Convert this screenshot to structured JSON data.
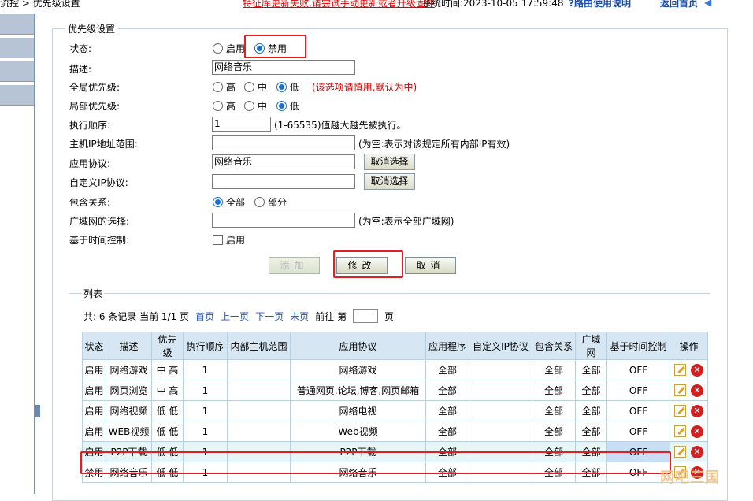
{
  "topbar": {
    "breadcrumb": "流控 > 优先级设置",
    "warning": "特征库更新失败,请尝试手动更新或者升级固件",
    "system_time": "系统时间:2023-10-05 17:59:48",
    "help": "路由使用说明",
    "back": "返回首页"
  },
  "form": {
    "legend": "优先级设置",
    "status_label": "状态:",
    "status_enable": "启用",
    "status_disable": "禁用",
    "status_value": "禁用",
    "desc_label": "描述:",
    "desc_value": "网络音乐",
    "global_label": "全局优先级:",
    "global_opts": [
      "高",
      "中",
      "低"
    ],
    "global_selected": "低",
    "global_hint": "(该选项请慎用,默认为中)",
    "local_label": "局部优先级:",
    "local_opts": [
      "高",
      "中",
      "低"
    ],
    "local_selected": "低",
    "order_label": "执行顺序:",
    "order_value": "1",
    "order_hint": "(1-65535)值越大越先被执行。",
    "ip_label": "主机IP地址范围:",
    "ip_value": "",
    "ip_hint": "(为空:表示对该规定所有内部IP有效)",
    "proto_label": "应用协议:",
    "proto_value": "网络音乐",
    "cancel_select": "取消选择",
    "custom_label": "自定义IP协议:",
    "custom_value": "",
    "include_label": "包含关系:",
    "include_all": "全部",
    "include_part": "部分",
    "include_selected": "全部",
    "wan_label": "广域网的选择:",
    "wan_value": "",
    "wan_hint": "(为空:表示全部广域网)",
    "time_label": "基于时间控制:",
    "time_enable": "启用",
    "btn_add": "添加",
    "btn_modify": "修改",
    "btn_cancel": "取消"
  },
  "list": {
    "legend": "列表",
    "summary": "共: 6 条记录 当前 1/1 页",
    "first": "首页",
    "prev": "上一页",
    "next": "下一页",
    "last": "末页",
    "goto": "前往 第",
    "page_suffix": "页",
    "headers": [
      "状态",
      "描述",
      "优先级",
      "执行顺序",
      "内部主机范围",
      "应用协议",
      "应用程序",
      "自定义IP协议",
      "包含关系",
      "广域网",
      "基于时间控制",
      "操作"
    ],
    "rows": [
      {
        "status": "启用",
        "desc": "网络游戏",
        "prio": "中 高",
        "order": "1",
        "host": "",
        "proto": "网络游戏",
        "app": "全部",
        "custom": "",
        "include": "全部",
        "wan": "全部",
        "time": "OFF"
      },
      {
        "status": "启用",
        "desc": "网页浏览",
        "prio": "中 高",
        "order": "1",
        "host": "",
        "proto": "普通网页,论坛,博客,网页邮箱",
        "app": "全部",
        "custom": "",
        "include": "全部",
        "wan": "全部",
        "time": "OFF"
      },
      {
        "status": "启用",
        "desc": "网络视频",
        "prio": "低 低",
        "order": "1",
        "host": "",
        "proto": "网络电视",
        "app": "全部",
        "custom": "",
        "include": "全部",
        "wan": "全部",
        "time": "OFF"
      },
      {
        "status": "启用",
        "desc": "WEB视频",
        "prio": "低 低",
        "order": "1",
        "host": "",
        "proto": "Web视频",
        "app": "全部",
        "custom": "",
        "include": "全部",
        "wan": "全部",
        "time": "OFF"
      },
      {
        "status": "启用",
        "desc": "P2P下载",
        "prio": "低 低",
        "order": "1",
        "host": "",
        "proto": "P2P下载",
        "app": "全部",
        "custom": "",
        "include": "全部",
        "wan": "全部",
        "time": "OFF"
      },
      {
        "status": "禁用",
        "desc": "网络音乐",
        "prio": "低 低",
        "order": "1",
        "host": "",
        "proto": "网络音乐",
        "app": "全部",
        "custom": "",
        "include": "全部",
        "wan": "全部",
        "time": "OFF"
      }
    ]
  },
  "watermark": "网吧三国"
}
